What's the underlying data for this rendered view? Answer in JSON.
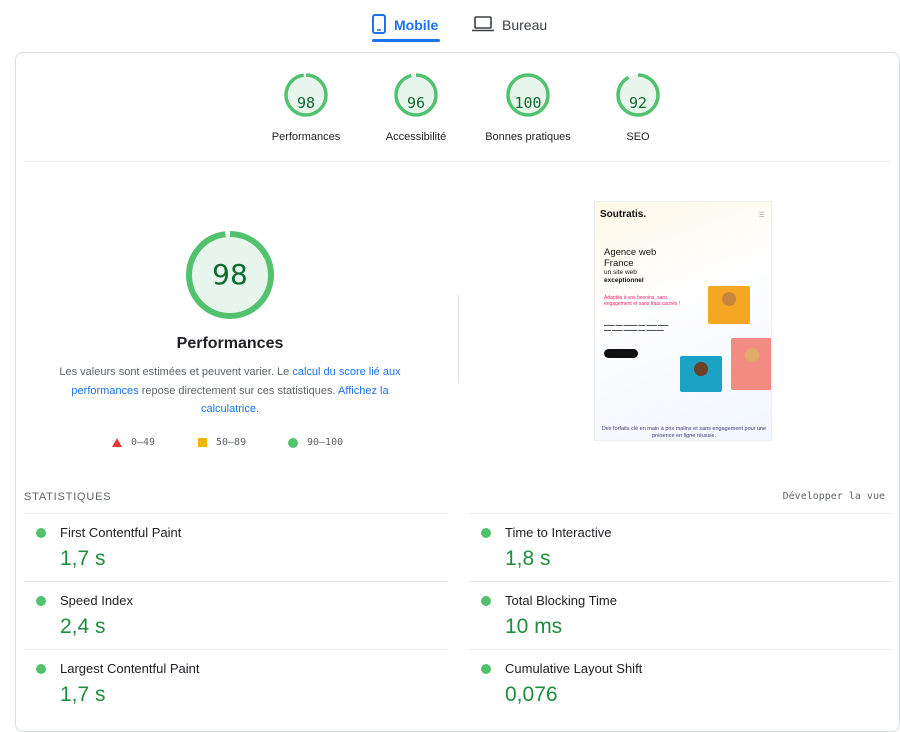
{
  "tabs": [
    {
      "label": "Mobile",
      "icon": "smartphone-icon",
      "active": true
    },
    {
      "label": "Bureau",
      "icon": "laptop-icon",
      "active": false
    }
  ],
  "category_scores": [
    {
      "score": "98",
      "label": "Performances"
    },
    {
      "score": "96",
      "label": "Accessibilité"
    },
    {
      "score": "100",
      "label": "Bonnes pratiques"
    },
    {
      "score": "92",
      "label": "SEO"
    }
  ],
  "performance": {
    "score": "98",
    "title": "Performances",
    "desc_part1": "Les valeurs sont estimées et peuvent varier. Le ",
    "desc_link1": "calcul du score lié aux performances",
    "desc_part2": " repose directement sur ces statistiques. ",
    "desc_link2": "Affichez la calculatrice",
    "desc_part3": "."
  },
  "legend": [
    {
      "icon": "fail-triangle-icon",
      "range": "0–49"
    },
    {
      "icon": "average-square-icon",
      "range": "50–89"
    },
    {
      "icon": "pass-circle-icon",
      "range": "90–100"
    }
  ],
  "screenshot": {
    "logo": "Soutratis.",
    "headline": "Agence web France",
    "sub1": "un site web",
    "sub2": "exceptionnel",
    "pink": "Adaptés à vos besoins, sans engagement et sans frais cachés !",
    "bottom": "Des forfaits clé en main à prix malins et sans engagement pour une présence en ligne réussie."
  },
  "stats": {
    "title": "STATISTIQUES",
    "expand_label": "Développer la vue",
    "metrics": [
      {
        "label": "First Contentful Paint",
        "value": "1,7 s"
      },
      {
        "label": "Time to Interactive",
        "value": "1,8 s"
      },
      {
        "label": "Speed Index",
        "value": "2,4 s"
      },
      {
        "label": "Total Blocking Time",
        "value": "10 ms"
      },
      {
        "label": "Largest Contentful Paint",
        "value": "1,7 s"
      },
      {
        "label": "Cumulative Layout Shift",
        "value": "0,076"
      }
    ]
  },
  "colors": {
    "accent": "#1a73e8",
    "pass": "#0c6b2d",
    "pass_ring": "#52c26f",
    "pass_fill": "#e8f5ec"
  }
}
